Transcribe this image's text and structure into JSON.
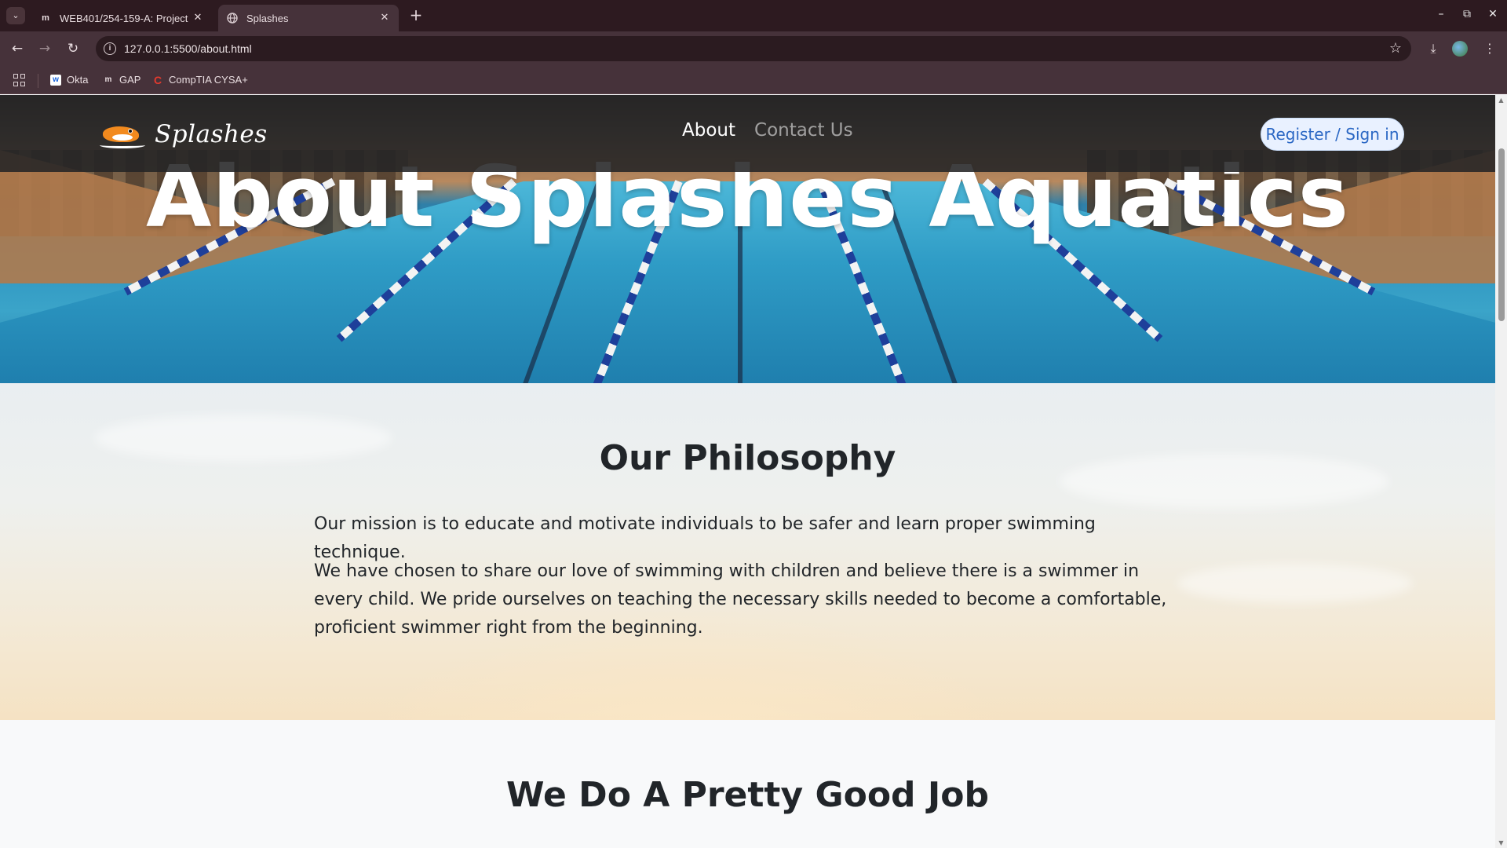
{
  "browser": {
    "tabs": [
      {
        "title": "WEB401/254-159-A: Project",
        "favicon": "m",
        "active": false
      },
      {
        "title": "Splashes",
        "favicon": "globe",
        "active": true
      }
    ],
    "url": "127.0.0.1:5500/about.html",
    "bookmarks": [
      {
        "label": "Okta",
        "icon": "okta-icon"
      },
      {
        "label": "GAP",
        "icon": "m-icon"
      },
      {
        "label": "CompTIA CYSA+",
        "icon": "comptia-icon"
      }
    ]
  },
  "site": {
    "brand": "Splashes",
    "nav": {
      "about": "About",
      "contact": "Contact Us",
      "register": "Register / Sign in"
    },
    "hero_title": "About Splashes Aquatics",
    "philosophy": {
      "title": "Our Philosophy",
      "p1": "Our mission is to educate and motivate individuals to be safer and learn proper swimming technique.",
      "p2": "We have chosen to share our love of swimming with children and believe there is a swimmer in every child. We pride ourselves on teaching the necessary skills needed to become a comfortable, proficient swimmer right from the beginning."
    },
    "job": {
      "title": "We Do A Pretty Good Job"
    }
  },
  "colors": {
    "browser_frame": "#2d1a20",
    "toolbar": "#46323a",
    "nav_bg": "#242426",
    "register_text": "#2a67c4",
    "heading_text": "#212529"
  }
}
